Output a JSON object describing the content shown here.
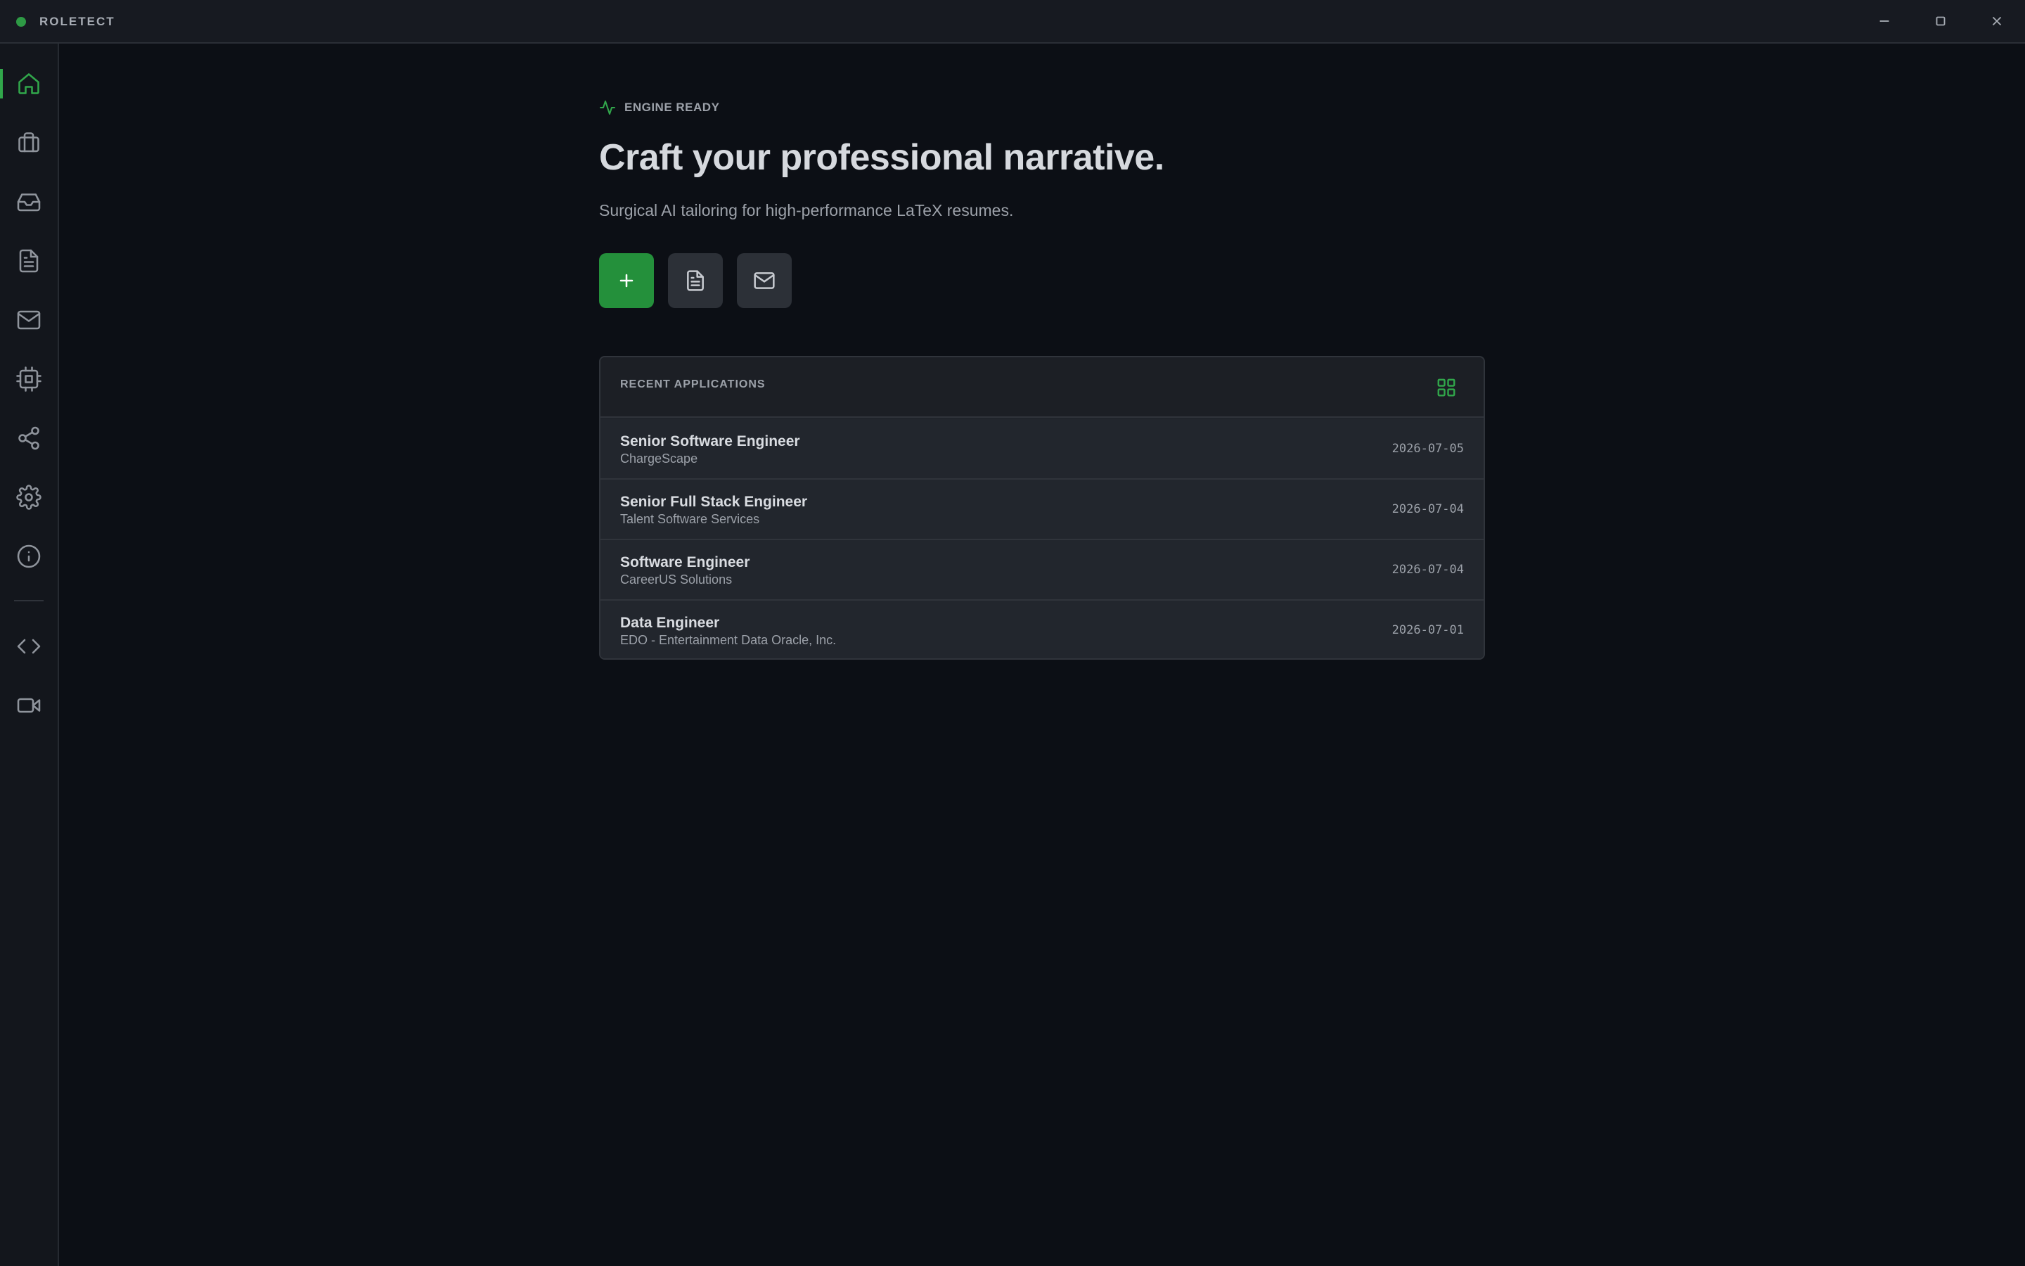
{
  "window": {
    "title": "ROLETECT",
    "accent": "#31a74b"
  },
  "sidebar": {
    "items": [
      {
        "name": "home",
        "icon": "home-icon",
        "active": true
      },
      {
        "name": "jobs",
        "icon": "briefcase-icon"
      },
      {
        "name": "inbox",
        "icon": "inbox-icon"
      },
      {
        "name": "documents",
        "icon": "file-text-icon"
      },
      {
        "name": "mail",
        "icon": "mail-icon"
      },
      {
        "name": "engine",
        "icon": "cpu-icon"
      },
      {
        "name": "share",
        "icon": "share-icon"
      },
      {
        "name": "settings",
        "icon": "gear-icon"
      },
      {
        "name": "about",
        "icon": "info-icon"
      },
      {
        "name": "developer",
        "icon": "code-icon"
      },
      {
        "name": "video",
        "icon": "video-icon"
      }
    ]
  },
  "main": {
    "status_label": "ENGINE READY",
    "headline": "Craft your professional narrative.",
    "subtitle": "Surgical AI tailoring for high-performance LaTeX resumes."
  },
  "recent": {
    "title": "RECENT APPLICATIONS",
    "rows": [
      {
        "title": "Senior Software Engineer",
        "company": "ChargeScape",
        "date": "2026-07-05"
      },
      {
        "title": "Senior Full Stack Engineer",
        "company": "Talent Software Services",
        "date": "2026-07-04"
      },
      {
        "title": "Software Engineer",
        "company": "CareerUS Solutions",
        "date": "2026-07-04"
      },
      {
        "title": "Data Engineer",
        "company": "EDO - Entertainment Data Oracle, Inc.",
        "date": "2026-07-01"
      }
    ]
  }
}
